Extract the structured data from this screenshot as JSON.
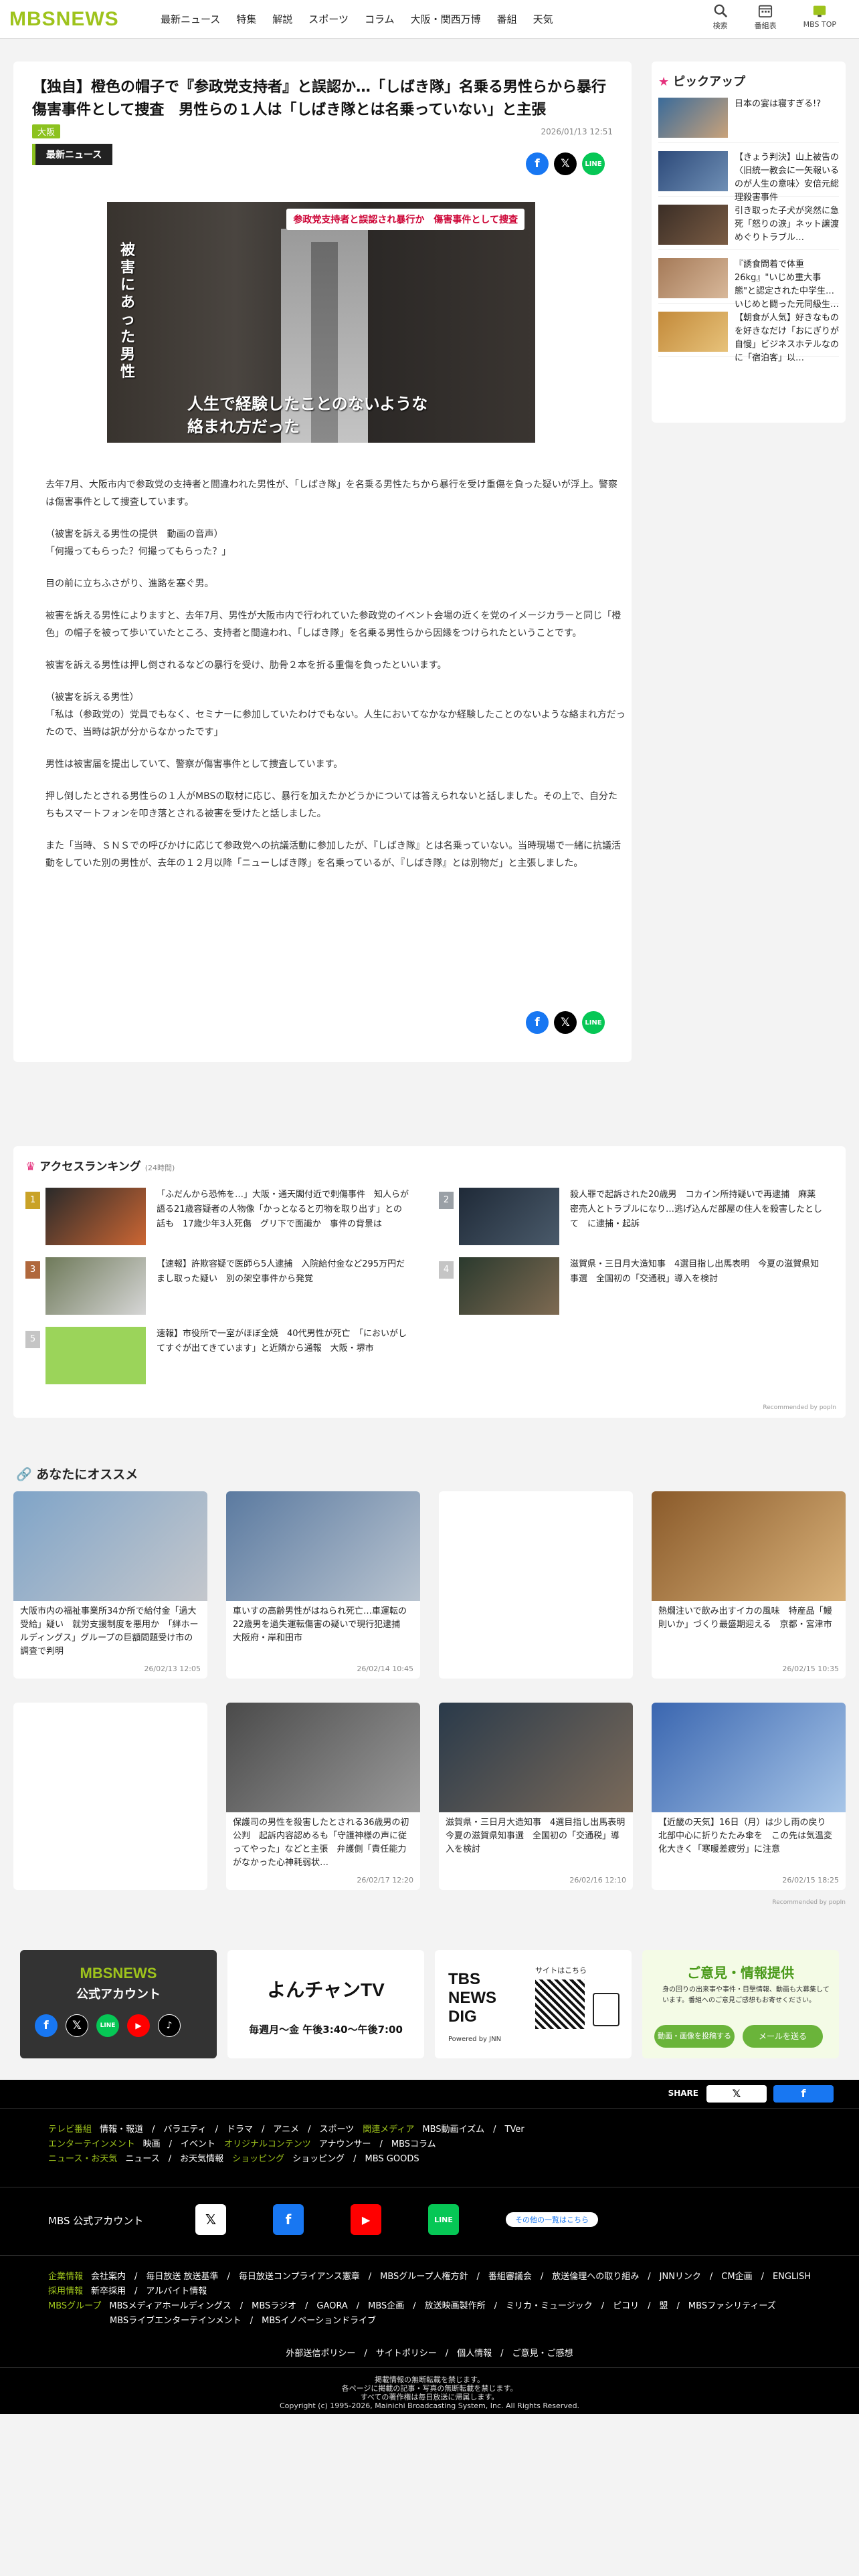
{
  "header": {
    "logo": "MBSNEWS",
    "nav": [
      "最新ニュース",
      "特集",
      "解説",
      "スポーツ",
      "コラム",
      "大阪・関西万博",
      "番組",
      "天気"
    ],
    "icons": [
      {
        "icon": "search-icon",
        "label": "検索"
      },
      {
        "icon": "calendar-icon",
        "label": "番組表"
      },
      {
        "icon": "tv-icon",
        "label": "MBS TOP"
      }
    ]
  },
  "article": {
    "title": "【独自】橙色の帽子で『参政党支持者』と誤認か…「しばき隊」名乗る男性らから暴行　傷害事件として捜査　男性らの１人は「しばき隊とは名乗っていない」と主張",
    "tag": "大阪",
    "date": "2026/01/13 12:51",
    "label": "最新ニュース",
    "photo_caption_top": "参政党支持者と誤認され暴行か　傷害事件として捜査",
    "photo_side": "被害にあった男性",
    "photo_sub1": "人生で経験したことのないような",
    "photo_sub2": "絡まれ方だった",
    "paragraphs": [
      "去年7月、大阪市内で参政党の支持者と間違われた男性が、「しばき隊」を名乗る男性たちから暴行を受け重傷を負った疑いが浮上。警察は傷害事件として捜査しています。",
      "（被害を訴える男性の提供　動画の音声）\n「何撮ってもらった？何撮ってもらった？」",
      "目の前に立ちふさがり、進路を塞ぐ男。",
      "被害を訴える男性によりますと、去年7月、男性が大阪市内で行われていた参政党のイベント会場の近くを党のイメージカラーと同じ「橙色」の帽子を被って歩いていたところ、支持者と間違われ、「しばき隊」を名乗る男性らから因縁をつけられたということです。",
      "被害を訴える男性は押し倒されるなどの暴行を受け、肋骨２本を折る重傷を負ったといいます。",
      "（被害を訴える男性）\n「私は（参政党の）党員でもなく、セミナーに参加していたわけでもない。人生においてなかなか経験したことのないような絡まれ方だったので、当時は訳が分からなかったです」",
      "男性は被害届を提出していて、警察が傷害事件として捜査しています。",
      "押し倒したとされる男性らの１人がMBSの取材に応じ、暴行を加えたかどうかについては答えられないと話しました。その上で、自分たちもスマートフォンを叩き落とされる被害を受けたと話しました。",
      "また「当時、ＳＮＳでの呼びかけに応じて参政党への抗議活動に参加したが、『しばき隊』とは名乗っていない。当時現場で一緒に抗議活動をしていた別の男性が、去年の１２月以降「ニューしばき隊」を名乗っているが、『しばき隊』とは別物だ」と主張しました。"
    ]
  },
  "pickup": {
    "heading": "ピックアップ",
    "items": [
      "日本の宴は寝すぎる!?",
      "【きょう判決】山上被告の〈旧統一教会に一矢報いるのが人生の意味〉安倍元総理殺害事件",
      "引き取った子犬が突然に急死「怒りの涙」ネット譲渡めぐりトラブル…",
      "『誘食問着で体重26kg』\"いじめ重大事態\"と認定された中学生…いじめと闘った元同級生…",
      "【朝食が人気】好きなものを好きなだけ「おにぎりが自慢」ビジネスホテルなのに「宿泊客」以…"
    ]
  },
  "ranking": {
    "heading": "アクセスランキング",
    "sub": "(24時間)",
    "items": [
      {
        "rank": "1",
        "title": "「ふだんから恐怖を…」大阪・通天閣付近で刺傷事件　知人らが語る21歳容疑者の人物像「かっとなると刃物を取り出す」との話も　17歳少年3人死傷　グリ下で面識か　事件の背景は"
      },
      {
        "rank": "2",
        "title": "殺人罪で起訴された20歳男　コカイン所持疑いで再逮捕　麻薬密売人とトラブルになり…逃げ込んだ部屋の住人を殺害したとして　に逮捕・起訴"
      },
      {
        "rank": "3",
        "title": "【速報】許欺容疑で医師ら5人逮捕　入院給付金など295万円だまし取った疑い　別の架空事件から発覚"
      },
      {
        "rank": "4",
        "title": "滋賀県・三日月大造知事　4選目指し出馬表明　今夏の滋賀県知事選　全国初の「交通税」導入を検討"
      },
      {
        "rank": "5",
        "title": "速報】市役所で一室がほぼ全焼　40代男性が死亡　「においがしてすぐが出てきています」と近隣から通報　大阪・堺市"
      }
    ],
    "recommended": "Recommended by popIn"
  },
  "recommend": {
    "heading": "あなたにオススメ",
    "cards": [
      {
        "title": "大阪市内の福祉事業所34か所で給付金「過大受給」疑い　就労支援制度を悪用か　「絆ホールディングス」グループの巨額問題受け市の調査で判明",
        "date": "26/02/13 12:05"
      },
      {
        "title": "車いすの高齢男性がはねられ死亡…車運転の22歳男を過失運転傷害の疑いで現行犯逮捕　大阪府・岸和田市",
        "date": "26/02/14 10:45"
      },
      {
        "title": "",
        "date": ""
      },
      {
        "title": "熱燗注いで飲み出すイカの風味　特産品「鰻則いか」づくり最盛期迎える　京都・宮津市",
        "date": "26/02/15 10:35"
      },
      {
        "title": "",
        "date": ""
      },
      {
        "title": "保護司の男性を殺害したとされる36歳男の初公判　起訴内容認めるも「守護神様の声に従ってやった」などと主張　弁護側「責任能力がなかった心神耗弱状…",
        "date": "26/02/17 12:20"
      },
      {
        "title": "滋賀県・三日月大造知事　4選目指し出馬表明　今夏の滋賀県知事選　全国初の「交通税」導入を検討",
        "date": "26/02/16 12:10"
      },
      {
        "title": "【近畿の天気】16日（月）は少し雨の戻り　北部中心に折りたたみ傘を　この先は気温変化大きく「寒暖差疲労」に注意",
        "date": "26/02/15 18:25"
      }
    ],
    "recommended": "Recommended by popIn"
  },
  "banners": {
    "account_title": "MBSNEWS",
    "account_sub": "公式アカウント",
    "yonchan": "よんチャンTV",
    "yonchan_time": "毎週月～金 午後3:40～午後7:00",
    "dig": "TBS NEWS DIG",
    "dig_sub": "Powered by JNN",
    "dig_app": "サイトはこちら",
    "opinion": "ご意見・情報提供",
    "opinion_desc": "身の回りの出来事や事件・目撃情報、動画も大募集しています。番組へのご意見ご感想もお寄せください。",
    "opinion_btn1": "動画・画像を投稿する",
    "opinion_btn2": "メールを送る"
  },
  "footer": {
    "share": "SHARE",
    "rows": [
      {
        "k": "テレビ番組",
        "v": "情報・報道　/　バラエティ　/　ドラマ　/　アニメ　/　スポーツ",
        "k2": "関連メディア",
        "v2": "MBS動画イズム　/　TVer"
      },
      {
        "k": "エンターテインメント",
        "v": "映画　/　イベント",
        "k2": "オリジナルコンテンツ",
        "v2": "アナウンサー　/　MBSコラム"
      },
      {
        "k": "ニュース・お天気",
        "v": "ニュース　/　お天気情報",
        "k2": "ショッピング",
        "v2": "ショッピング　/　MBS GOODS"
      }
    ],
    "official": "MBS 公式アカウント",
    "official_more": "その他の一覧はこちら",
    "corp": [
      {
        "k": "企業情報",
        "v": "会社案内　/　毎日放送 放送基準　/　毎日放送コンプライアンス憲章　/　MBSグループ人権方針　/　番組審議会　/　放送倫理への取り組み　/　JNNリンク　/　CM企画　/　ENGLISH"
      },
      {
        "k": "採用情報",
        "v": "新卒採用　/　アルバイト情報"
      },
      {
        "k": "MBSグループ",
        "v": "MBSメディアホールディングス　/　MBSラジオ　/　GAORA　/　MBS企画　/　放送映画製作所　/　ミリカ・ミュージック　/　ピコリ　/　盟　/　MBSファシリティーズ"
      },
      {
        "k": "",
        "v": "MBSライブエンターテインメント　/　MBSイノベーションドライブ"
      }
    ],
    "policy": "外部送信ポリシー　/　サイトポリシー　/　個人情報　/　ご意見・ご感想",
    "copy1": "掲載情報の無断転載を禁じます。",
    "copy2": "各ページに掲載の記事・写真の無断転載を禁じます。",
    "copy3": "すべての著作権は毎日放送に帰属します。",
    "copy4": "Copyright (c) 1995-2026, Mainichi Broadcasting System, Inc. All Rights Reserved."
  },
  "colors": {
    "brand": "#9ec31c",
    "accent": "#e4307b",
    "facebook": "#1877f2",
    "line": "#06c755"
  }
}
